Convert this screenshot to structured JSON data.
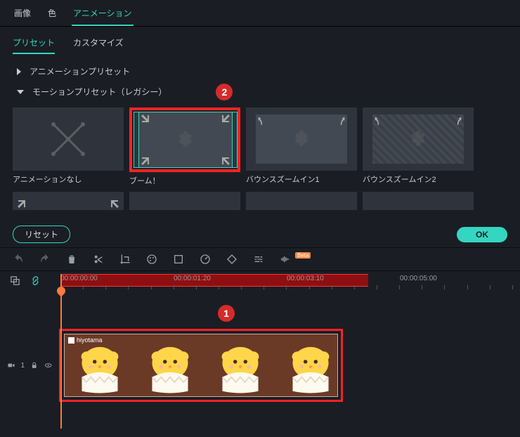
{
  "tabs": {
    "image": "画像",
    "color": "色",
    "animation": "アニメーション"
  },
  "subtabs": {
    "preset": "プリセット",
    "customize": "カスタマイズ"
  },
  "accordion": {
    "anim_preset": "アニメーションプリセット",
    "motion_preset": "モーションプリセット（レガシー）"
  },
  "presets": {
    "none": "アニメーションなし",
    "boom": "ブーム！",
    "bounce1": "バウンスズームイン1",
    "bounce2": "バウンスズームイン2"
  },
  "footer": {
    "reset": "リセット",
    "ok": "OK"
  },
  "markers": {
    "step1": "1",
    "step2": "2"
  },
  "toolbar_badge": "Beta",
  "timecodes": {
    "t0": "00:00:00:00",
    "t1": "00:00:01:20",
    "t2": "00:00:03:10",
    "t3": "00:00:05:00"
  },
  "clip": {
    "name": "hiyotama"
  },
  "track_label": "1"
}
